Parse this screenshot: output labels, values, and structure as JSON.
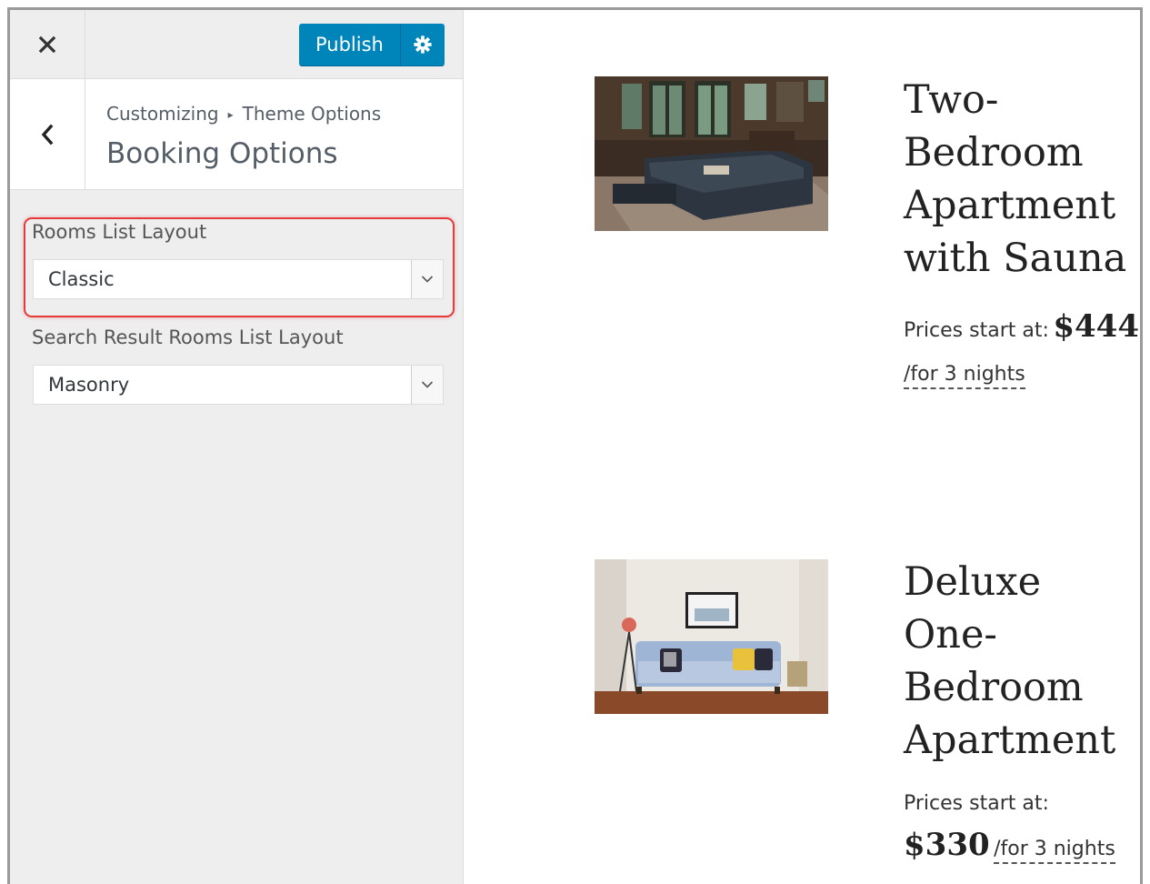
{
  "topbar": {
    "close_icon": "close-icon",
    "publish_label": "Publish",
    "settings_icon": "gear-icon"
  },
  "section": {
    "back_icon": "chevron-left-icon",
    "breadcrumb_root": "Customizing",
    "breadcrumb_separator": "▸",
    "breadcrumb_parent": "Theme Options",
    "title": "Booking Options"
  },
  "controls": {
    "rooms_list_layout": {
      "label": "Rooms List Layout",
      "value": "Classic"
    },
    "search_result_layout": {
      "label": "Search Result Rooms List Layout",
      "value": "Masonry"
    }
  },
  "rooms": [
    {
      "title_lines": [
        "Two-",
        "Bedroom",
        "Apartment",
        "with Sauna"
      ],
      "price_label": "Prices start at:",
      "price": "$444",
      "period": "/for 3 nights"
    },
    {
      "title_lines": [
        "Deluxe",
        "One-",
        "Bedroom",
        "Apartment"
      ],
      "price_label": "Prices start at:",
      "price": "$330",
      "period": "/for 3 nights"
    }
  ],
  "colors": {
    "accent": "#0085ba",
    "highlight": "#e53a3a",
    "sidebar_bg": "#eeeeee"
  }
}
